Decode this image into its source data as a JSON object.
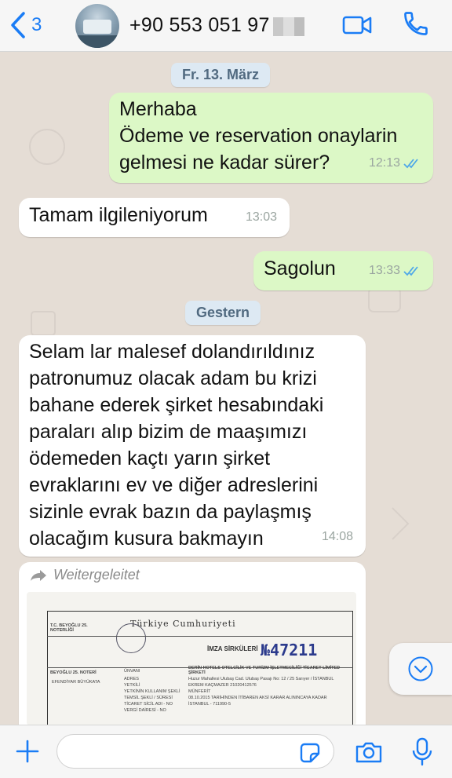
{
  "header": {
    "back_count": "3",
    "contact_phone": "+90 553 051 97",
    "icons": {
      "back": "chevron-left-icon",
      "video": "video-call-icon",
      "call": "phone-icon"
    }
  },
  "chat": {
    "date_separators": [
      "Fr. 13. März",
      "Gestern"
    ],
    "messages": [
      {
        "direction": "outgoing",
        "lines": [
          "Merhaba",
          "Ödeme ve reservation onaylarin",
          "gelmesi ne kadar sürer?"
        ],
        "time": "12:13",
        "status": "read"
      },
      {
        "direction": "incoming",
        "lines": [
          "Tamam ilgileniyorum"
        ],
        "time": "13:03"
      },
      {
        "direction": "outgoing",
        "lines": [
          "Sagolun"
        ],
        "time": "13:33",
        "status": "read"
      },
      {
        "direction": "incoming",
        "lines": [
          "Selam lar malesef dolandırıldınız",
          "patronumuz olacak adam bu krizi",
          "bahane ederek şirket hesabındaki",
          "paraları alıp bizim de maaşımızı",
          "ödemeden kaçtı yarın şirket",
          "evraklarını ev ve diğer adreslerini",
          "sizinle evrak bazın da paylaşmış",
          "olacağım kusura bakmayın"
        ],
        "time": "14:08"
      }
    ],
    "forwarded": {
      "label": "Weitergeleitet",
      "document": {
        "title": "Türkiye Cumhuriyeti",
        "heading": "İMZA SİRKÜLERİ",
        "number": "№47211",
        "left_stamp": "T.C. BEYOĞLU 25. NOTERLİĞİ",
        "notary": "BEYOĞLU 25. NOTERİ",
        "notary_sub": "EFENDİYAR BÜYÜKATA",
        "company": "DERİN HOTELS OTELCİLİK VE TURİZM İŞLETMECİLİĞİ TİCARET LİMİTED ŞİRKETİ",
        "address": "Huzur Mahallesi Ulubaş Cad. Ulubaş Pasajı No: 12 / 25 Sarıyer / İSTANBUL",
        "authorized": "EKREM KAÇMAZER 21020412576",
        "representation": "MÜNFERİT",
        "term": "08.10.2015 TARİHİNDEN İTİBAREN AKSİ KARAR ALININCAYA KADAR",
        "registry": "İSTANBUL - 711990-5",
        "rows": [
          "ÜNVANI",
          "ADRES",
          "YETKİLİ",
          "YETKİNİN KULLANIM ŞEKLİ",
          "TEMSİL ŞEKLİ / SÜRESİ",
          "TİCARET SİCİL ADI - NO",
          "VERGİ DAİRESİ - NO"
        ]
      }
    }
  },
  "footer": {
    "input_placeholder": "",
    "icons": {
      "add": "plus-icon",
      "sticker": "sticker-icon",
      "camera": "camera-icon",
      "mic": "microphone-icon"
    }
  },
  "colors": {
    "accent": "#1a7cf5",
    "outgoing_bubble": "#dcf8c6",
    "incoming_bubble": "#ffffff",
    "chat_background": "#e5ddd5",
    "read_ticks": "#4fa8e8"
  }
}
